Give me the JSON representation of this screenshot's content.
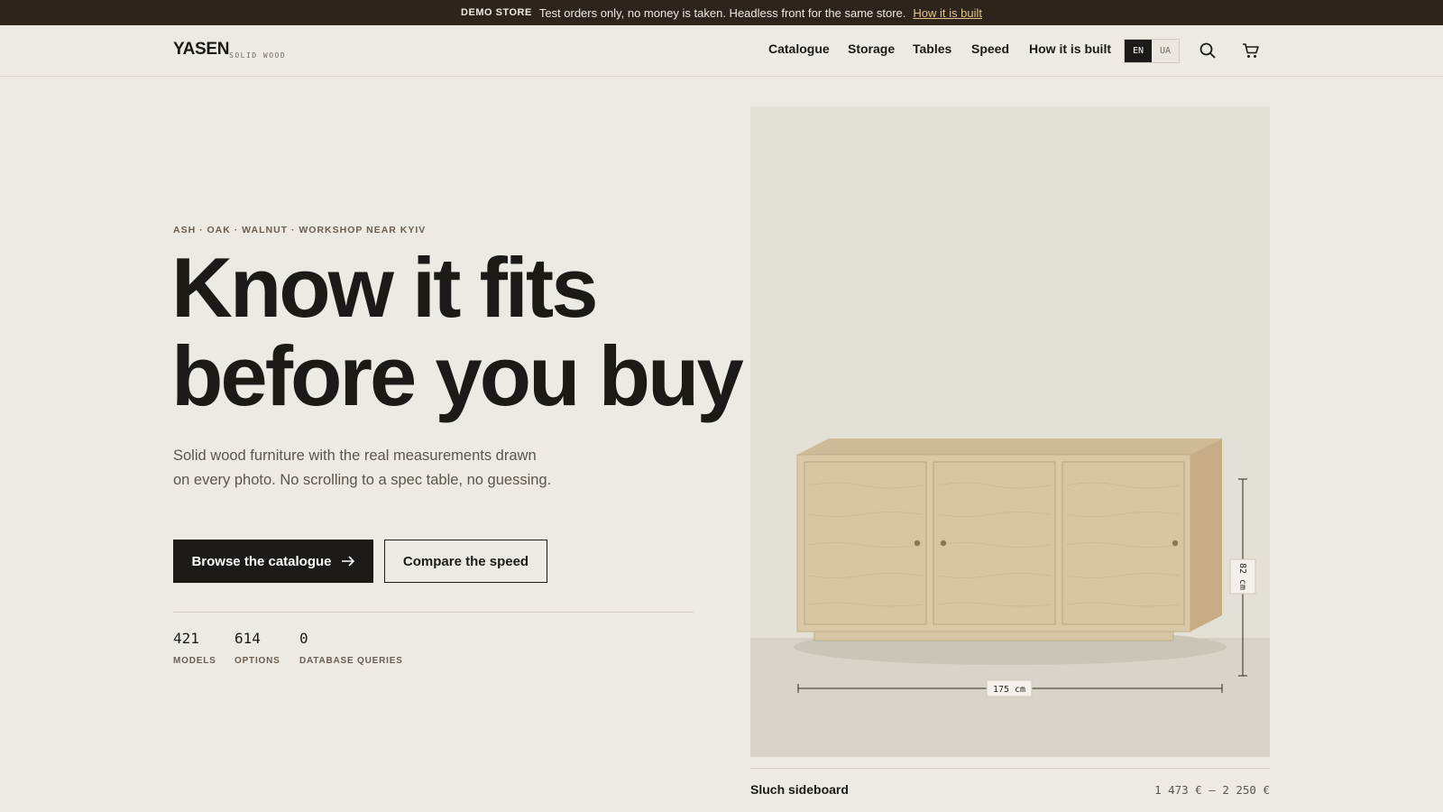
{
  "announcement": {
    "tag": "DEMO STORE",
    "message": "Test orders only, no money is taken.  Headless front for the same store.",
    "link": "How it is built"
  },
  "header": {
    "logo": "YASEN",
    "logo_sub": "SOLID WOOD",
    "nav": [
      "Catalogue",
      "Storage",
      "Tables",
      "Speed",
      "How it is built"
    ],
    "lang": {
      "active": "EN",
      "other": "UA"
    },
    "icons": [
      "search-icon",
      "cart-icon"
    ]
  },
  "hero": {
    "eyebrow": "ASH · OAK · WALNUT · WORKSHOP NEAR KYIV",
    "headline_line1": "Know it fits",
    "headline_line2": "before you buy",
    "lede": "Solid wood furniture with the real measurements drawn on every photo. No scrolling to a spec table, no guessing.",
    "primary_cta": "Browse the catalogue",
    "secondary_cta": "Compare the speed"
  },
  "stats": [
    {
      "value": "421",
      "label": "MODELS"
    },
    {
      "value": "614",
      "label": "OPTIONS"
    },
    {
      "value": "0",
      "label": "DATABASE QUERIES"
    }
  ],
  "product": {
    "name": "Sluch sideboard",
    "price": "1 473 € – 2 250 €",
    "width_label": "175 cm",
    "height_label": "82 cm"
  },
  "colors": {
    "announcement_bg": "#2d241c",
    "link": "#e4c38a",
    "page_bg": "#edeae3",
    "primary_button": "#1c1a17",
    "wood": "#d9c7a5"
  }
}
